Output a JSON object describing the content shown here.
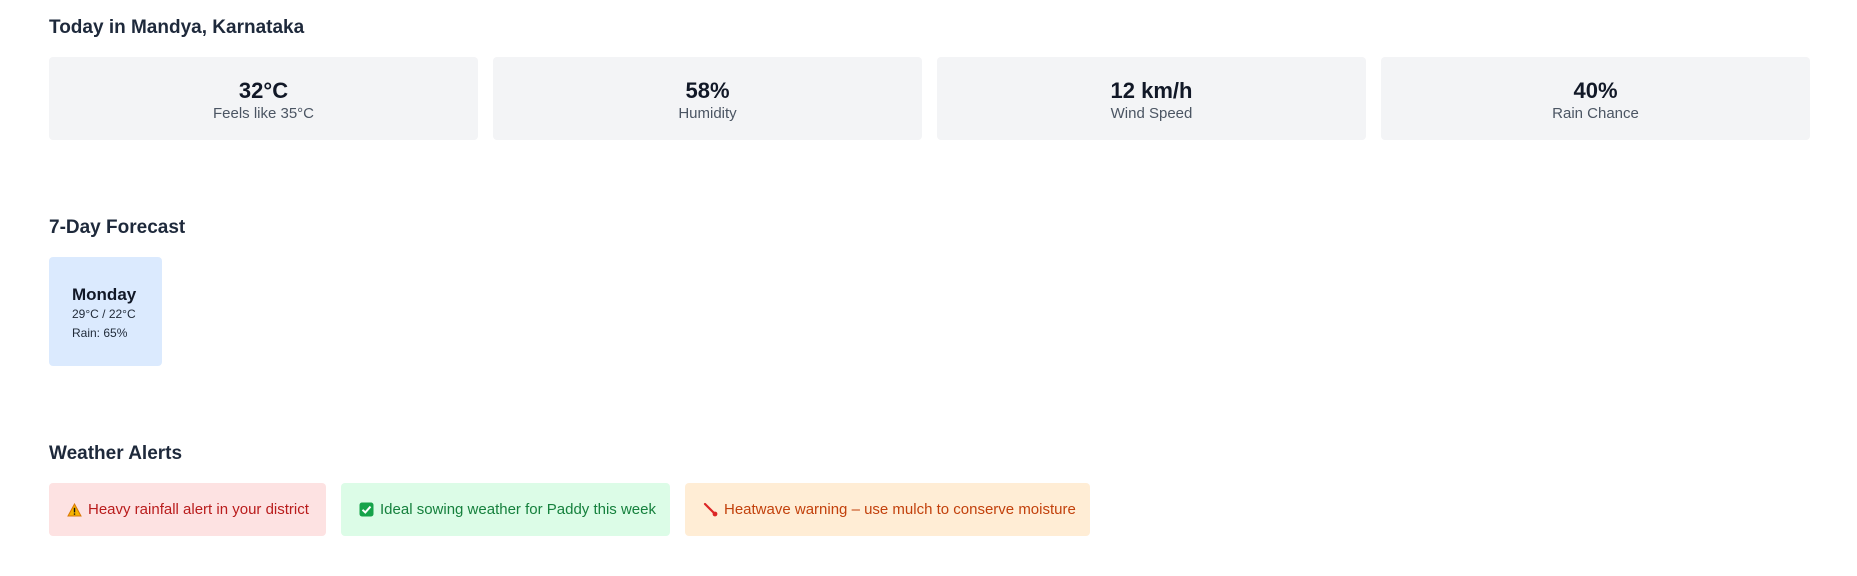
{
  "today": {
    "title": "Today in Mandya, Karnataka",
    "stats": [
      {
        "value": "32°C",
        "label": "Feels like 35°C"
      },
      {
        "value": "58%",
        "label": "Humidity"
      },
      {
        "value": "12 km/h",
        "label": "Wind Speed"
      },
      {
        "value": "40%",
        "label": "Rain Chance"
      }
    ]
  },
  "forecast": {
    "title": "7-Day Forecast",
    "days": [
      {
        "day": "Monday",
        "temps": "29°C / 22°C",
        "rain": "Rain: 65%"
      }
    ]
  },
  "alerts": {
    "title": "Weather Alerts",
    "items": [
      {
        "icon": "warning-icon",
        "text": "Heavy rainfall alert in your district",
        "color": "#b91c1c"
      },
      {
        "icon": "check-icon",
        "text": "Ideal sowing weather for Paddy this week",
        "color": "#15803d"
      },
      {
        "icon": "thermometer-icon",
        "text": "Heatwave warning – use mulch to conserve moisture",
        "color": "#c2410c"
      }
    ]
  }
}
